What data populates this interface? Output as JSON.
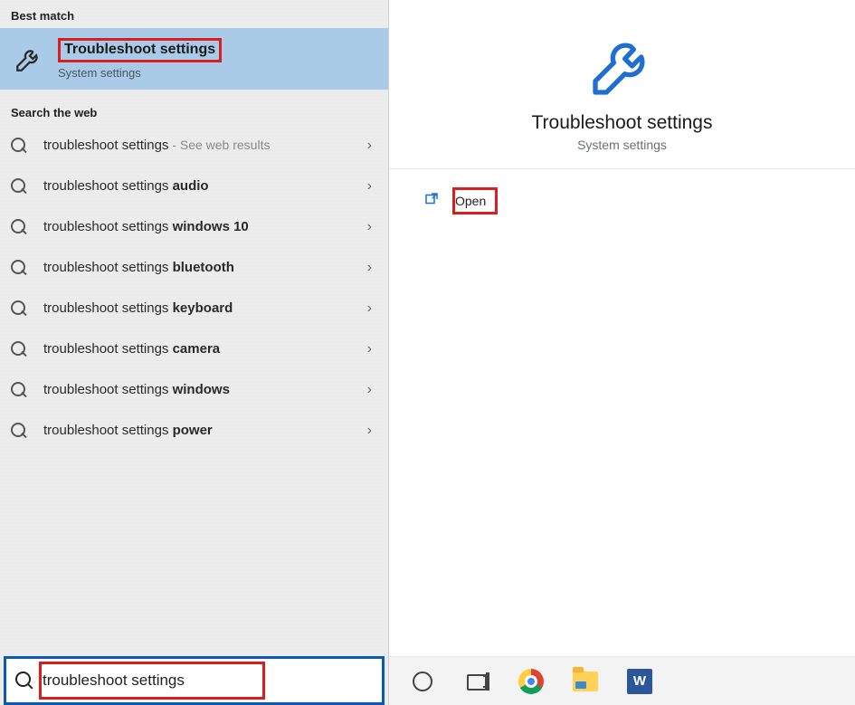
{
  "left_panel": {
    "best_match_header": "Best match",
    "best_match": {
      "title": "Troubleshoot settings",
      "subtitle": "System settings"
    },
    "search_web_header": "Search the web",
    "web_results": [
      {
        "prefix": "troubleshoot settings",
        "bold": "",
        "hint": " - See web results"
      },
      {
        "prefix": "troubleshoot settings ",
        "bold": "audio",
        "hint": ""
      },
      {
        "prefix": "troubleshoot settings ",
        "bold": "windows 10",
        "hint": ""
      },
      {
        "prefix": "troubleshoot settings ",
        "bold": "bluetooth",
        "hint": ""
      },
      {
        "prefix": "troubleshoot settings ",
        "bold": "keyboard",
        "hint": ""
      },
      {
        "prefix": "troubleshoot settings ",
        "bold": "camera",
        "hint": ""
      },
      {
        "prefix": "troubleshoot settings ",
        "bold": "windows",
        "hint": ""
      },
      {
        "prefix": "troubleshoot settings ",
        "bold": "power",
        "hint": ""
      }
    ],
    "search_value": "troubleshoot settings"
  },
  "right_panel": {
    "title": "Troubleshoot settings",
    "subtitle": "System settings",
    "open_label": "Open"
  },
  "taskbar": {
    "word_letter": "W"
  },
  "colors": {
    "highlight_red": "#d81e1e",
    "selection_blue": "#a9cbe8",
    "accent_blue": "#0a5ab0",
    "icon_blue": "#1f6fd0"
  }
}
